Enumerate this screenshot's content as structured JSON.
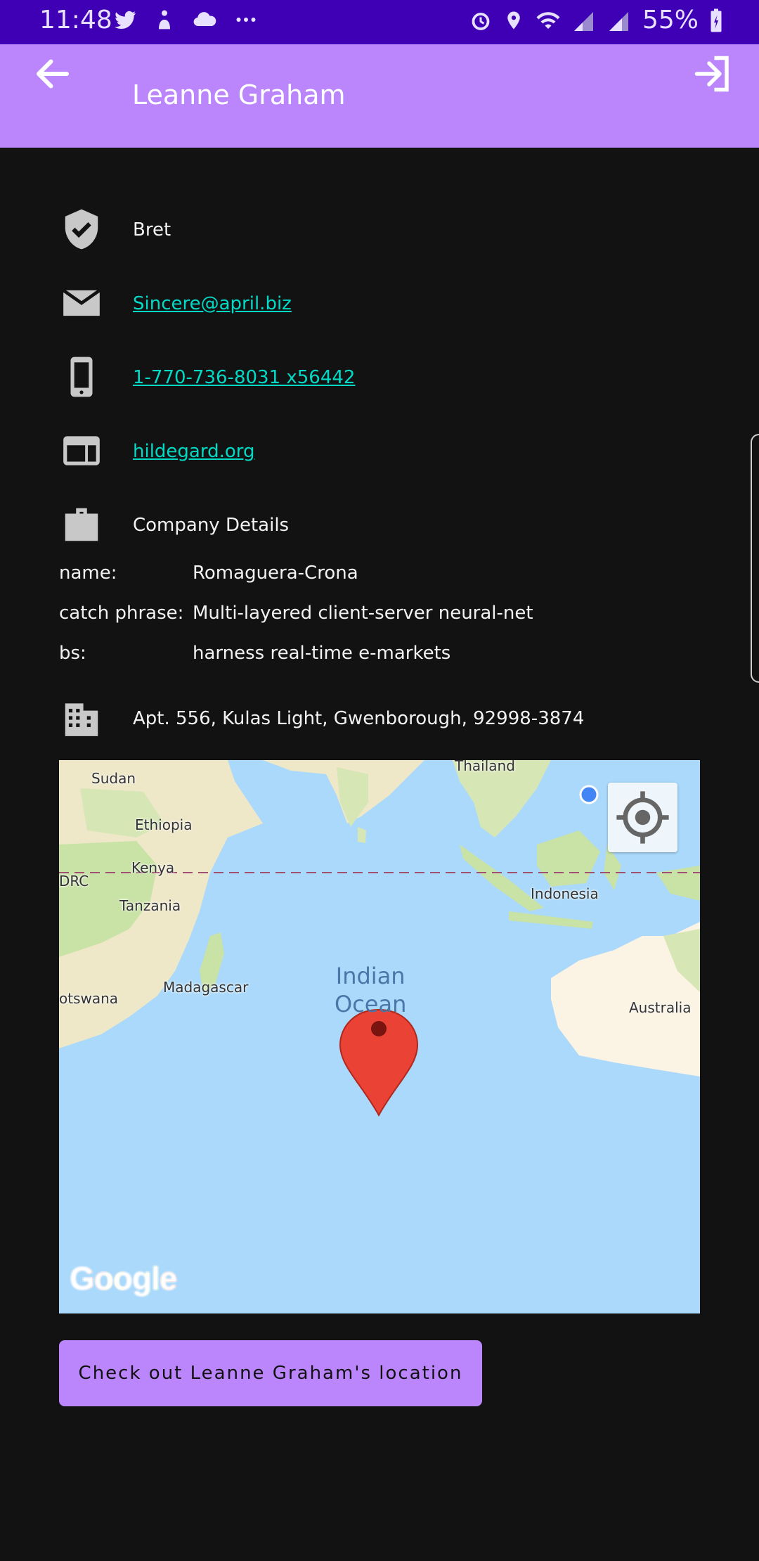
{
  "status_bar": {
    "time": "11:48",
    "battery": "55%"
  },
  "app_bar": {
    "title": "Leanne Graham"
  },
  "details": {
    "username": "Bret",
    "email": "Sincere@april.biz",
    "phone": "1-770-736-8031 x56442",
    "website": "hildegard.org",
    "company_heading": "Company Details",
    "address": "Apt. 556, Kulas Light, Gwenborough, 92998-3874"
  },
  "company": {
    "name_label": "name:",
    "name_value": "Romaguera-Crona",
    "catch_label": "catch phrase:",
    "catch_value": "Multi-layered client-server neural-net",
    "bs_label": "bs:",
    "bs_value": "harness real-time e-markets"
  },
  "map": {
    "labels": {
      "sudan": "Sudan",
      "thailand": "Thailand",
      "ethiopia": "Ethiopia",
      "kenya": "Kenya",
      "drc": "DRC",
      "tanzania": "Tanzania",
      "indonesia": "Indonesia",
      "madagascar": "Madagascar",
      "botswana": "otswana",
      "australia": "Australia",
      "ocean_line1": "Indian",
      "ocean_line2": "Ocean"
    },
    "attribution": "Google"
  },
  "cta": {
    "label": "Check out Leanne Graham's location"
  },
  "colors": {
    "accent": "#bb86fc",
    "link": "#03dac6",
    "status": "#3f00b5",
    "marker": "#ea4335"
  }
}
